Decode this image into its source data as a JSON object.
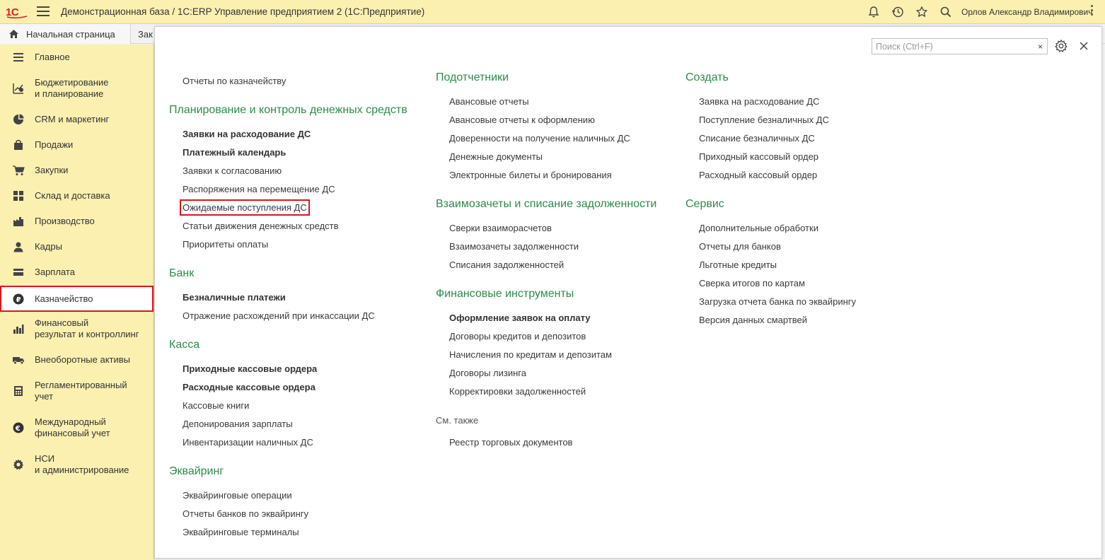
{
  "app": {
    "logo_text": "1С",
    "title": "Демонстрационная база / 1С:ERP Управление предприятием 2  (1С:Предприятие)",
    "user": "Орлов Александр Владимирович"
  },
  "tabs": {
    "home": "Начальная страница",
    "second": "Зак"
  },
  "sidebar": {
    "items": [
      {
        "label": "Главное",
        "icon": "menu-icon"
      },
      {
        "label": "Бюджетирование\nи планирование",
        "icon": "budget-icon"
      },
      {
        "label": "CRM и маркетинг",
        "icon": "pie-icon"
      },
      {
        "label": "Продажи",
        "icon": "bag-icon"
      },
      {
        "label": "Закупки",
        "icon": "cart-icon"
      },
      {
        "label": "Склад и доставка",
        "icon": "warehouse-icon"
      },
      {
        "label": "Производство",
        "icon": "factory-icon"
      },
      {
        "label": "Кадры",
        "icon": "person-icon"
      },
      {
        "label": "Зарплата",
        "icon": "wallet-icon"
      },
      {
        "label": "Казначейство",
        "icon": "ruble-icon"
      },
      {
        "label": "Финансовый\nрезультат и контроллинг",
        "icon": "chart-icon"
      },
      {
        "label": "Внеоборотные активы",
        "icon": "truck-icon"
      },
      {
        "label": "Регламентированный\nучет",
        "icon": "calculator-icon"
      },
      {
        "label": "Международный\nфинансовый учет",
        "icon": "euro-icon"
      },
      {
        "label": "НСИ\nи администрирование",
        "icon": "gear-icon"
      }
    ]
  },
  "search": {
    "placeholder": "Поиск (Ctrl+F)",
    "clear": "×"
  },
  "col1": {
    "top_link": "Отчеты по казначейству",
    "planning": {
      "title": "Планирование и контроль денежных средств",
      "items": [
        "Заявки на расходование ДС",
        "Платежный календарь",
        "Заявки к согласованию",
        "Распоряжения на перемещение ДС",
        "Ожидаемые поступления ДС",
        "Статьи движения денежных средств",
        "Приоритеты оплаты"
      ]
    },
    "bank": {
      "title": "Банк",
      "items": [
        "Безналичные платежи",
        "Отражение расхождений при инкассации ДС"
      ]
    },
    "cash": {
      "title": "Касса",
      "items": [
        "Приходные кассовые ордера",
        "Расходные кассовые ордера",
        "Кассовые книги",
        "Депонирования зарплаты",
        "Инвентаризации наличных ДС"
      ]
    },
    "acquiring": {
      "title": "Эквайринг",
      "items": [
        "Эквайринговые операции",
        "Отчеты банков по эквайрингу",
        "Эквайринговые терминалы"
      ]
    }
  },
  "col2": {
    "accountable": {
      "title": "Подотчетники",
      "items": [
        "Авансовые отчеты",
        "Авансовые отчеты к оформлению",
        "Доверенности на получение наличных ДС",
        "Денежные документы",
        "Электронные билеты и бронирования"
      ]
    },
    "offsets": {
      "title": "Взаимозачеты и списание задолженности",
      "items": [
        "Сверки взаиморасчетов",
        "Взаимозачеты задолженности",
        "Списания задолженностей"
      ]
    },
    "fin_tools": {
      "title": "Финансовые инструменты",
      "items": [
        "Оформление заявок на оплату",
        "Договоры кредитов и депозитов",
        "Начисления по кредитам и депозитам",
        "Договоры лизинга",
        "Корректировки задолженностей"
      ]
    },
    "see_also": {
      "title": "См. также",
      "items": [
        "Реестр торговых документов"
      ]
    }
  },
  "col3": {
    "create": {
      "title": "Создать",
      "items": [
        "Заявка на расходование ДС",
        "Поступление безналичных ДС",
        "Списание безналичных ДС",
        "Приходный кассовый ордер",
        "Расходный кассовый ордер"
      ]
    },
    "service": {
      "title": "Сервис",
      "items": [
        "Дополнительные обработки",
        "Отчеты для банков",
        "Льготные кредиты",
        "Сверка итогов по картам",
        "Загрузка отчета банка по эквайрингу",
        "Версия данных смартвей"
      ]
    }
  },
  "colors": {
    "accent_green": "#2e8b4b",
    "sidebar_bg": "#fbf0b0",
    "highlight_red": "#d9161c"
  }
}
